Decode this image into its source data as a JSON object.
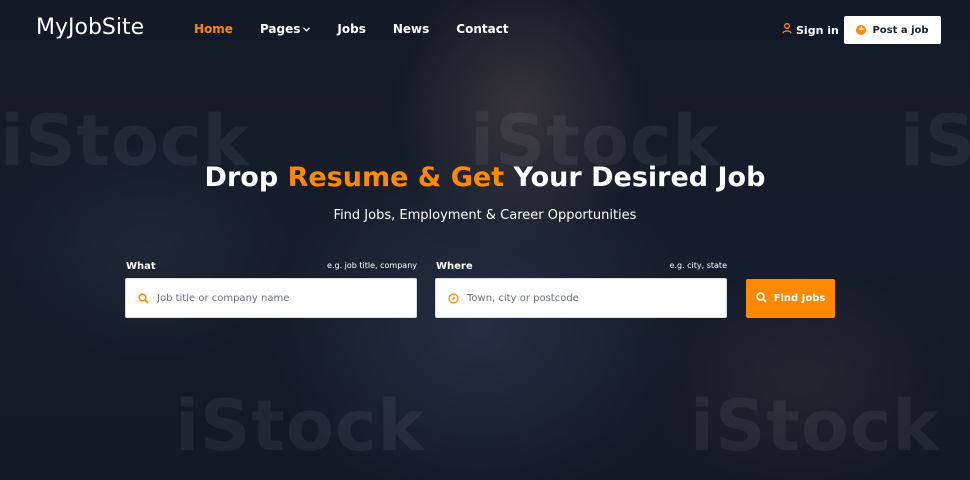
{
  "brand": {
    "logo_text": "MyJobSite"
  },
  "nav": {
    "items": [
      {
        "label": "Home",
        "active": true
      },
      {
        "label": "Pages",
        "has_dropdown": true
      },
      {
        "label": "Jobs"
      },
      {
        "label": "News"
      },
      {
        "label": "Contact"
      }
    ]
  },
  "header_actions": {
    "sign_in_label": "Sign in",
    "post_job_label": "Post a job"
  },
  "hero": {
    "headline_part1": "Drop ",
    "headline_accent": "Resume & Get",
    "headline_part2": " Your Desired Job",
    "subheading": "Find Jobs, Employment & Career Opportunities",
    "watermark_text": "iStock"
  },
  "search": {
    "what_label": "What",
    "what_hint": "e.g. job title, company",
    "what_placeholder": "Job title or company name",
    "what_value": "",
    "where_label": "Where",
    "where_hint": "e.g. city, state",
    "where_placeholder": "Town, city or postcode",
    "where_value": "",
    "submit_label": "Find Jobs"
  },
  "icons": {
    "user": "user-icon",
    "post": "plus-circle-icon",
    "search": "search-icon",
    "location": "compass-icon",
    "dropdown": "chevron-down-icon"
  },
  "colors": {
    "accent": "#ff8a00",
    "text_on_dark": "#ffffff",
    "button_bg": "#ffffff",
    "input_bg": "#ffffff"
  }
}
